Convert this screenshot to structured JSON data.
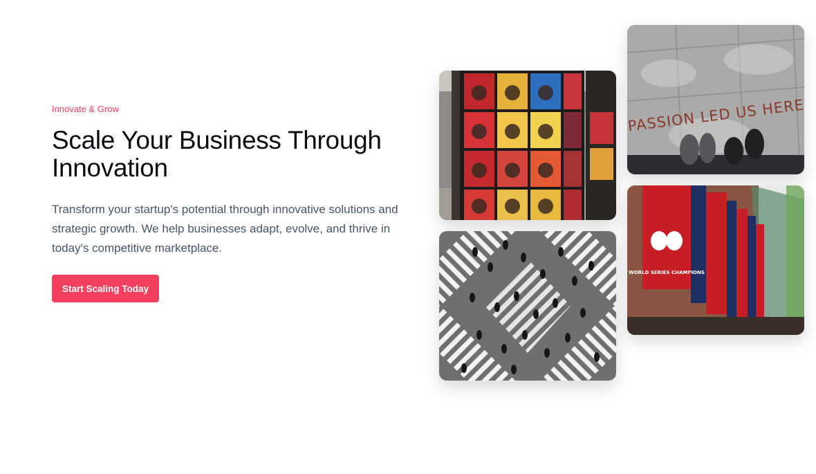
{
  "hero": {
    "eyebrow": "Innovate & Grow",
    "title_line_1": "Scale Your Business Through",
    "title_line_2": "Innovation",
    "description": "Transform your startup's potential through innovative solutions and strategic growth. We help businesses adapt, evolve, and thrive in today's competitive marketplace.",
    "cta_label": "Start Scaling Today"
  },
  "gallery": {
    "passion_text": "PASSION LED US HERE",
    "banner_text": "WORLD SERIES CHAMPIONS"
  },
  "colors": {
    "accent": "#f43f5e",
    "heading": "#0b0b12",
    "body_text": "#475569"
  }
}
